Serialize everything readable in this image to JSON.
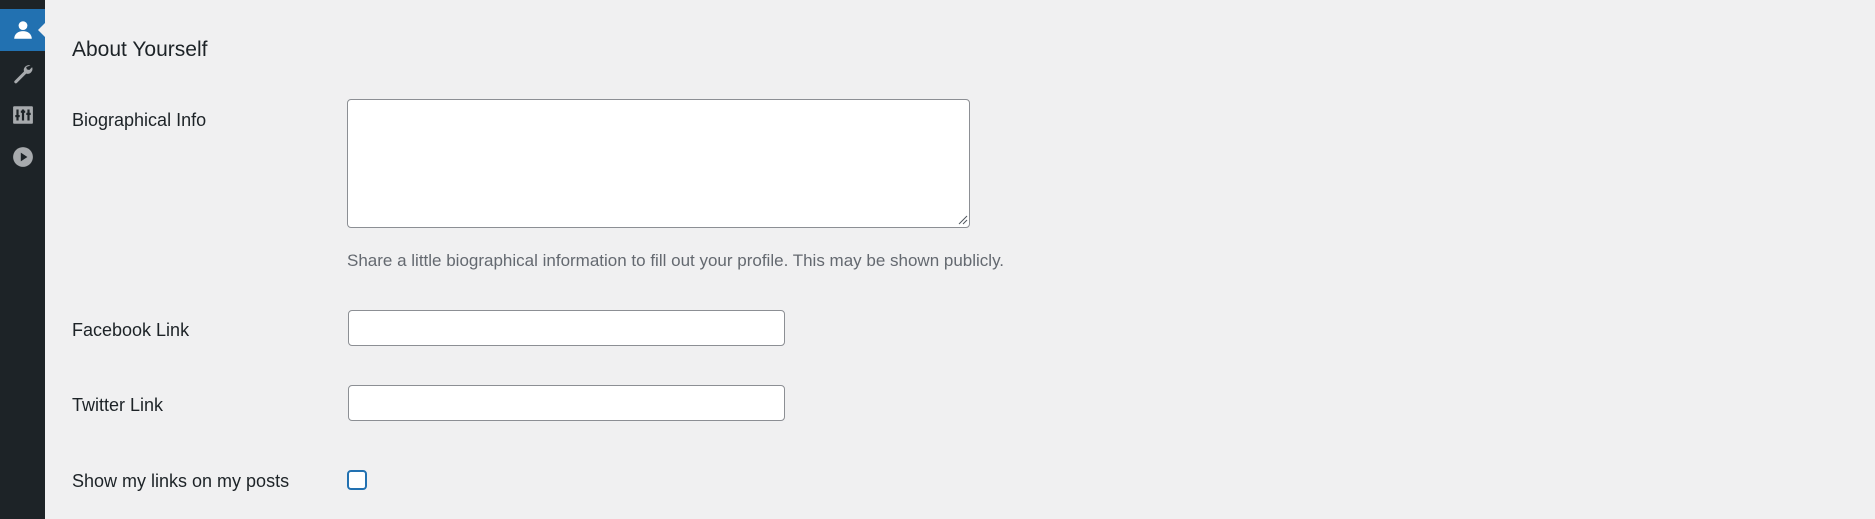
{
  "sidebar": {
    "items": [
      {
        "icon": "user-icon",
        "active": true
      },
      {
        "icon": "wrench-icon",
        "active": false
      },
      {
        "icon": "settings-sliders-icon",
        "active": false
      },
      {
        "icon": "play-icon",
        "active": false
      }
    ],
    "bg_color": "#1d2327",
    "active_color": "#2271b1"
  },
  "section": {
    "title": "About Yourself"
  },
  "fields": {
    "bio": {
      "label": "Biographical Info",
      "value": "",
      "hint": "Share a little biographical information to fill out your profile. This may be shown publicly."
    },
    "facebook": {
      "label": "Facebook Link",
      "value": "",
      "placeholder": ""
    },
    "twitter": {
      "label": "Twitter Link",
      "value": "",
      "placeholder": ""
    },
    "show_links": {
      "label": "Show my links on my posts",
      "checked": false
    }
  }
}
